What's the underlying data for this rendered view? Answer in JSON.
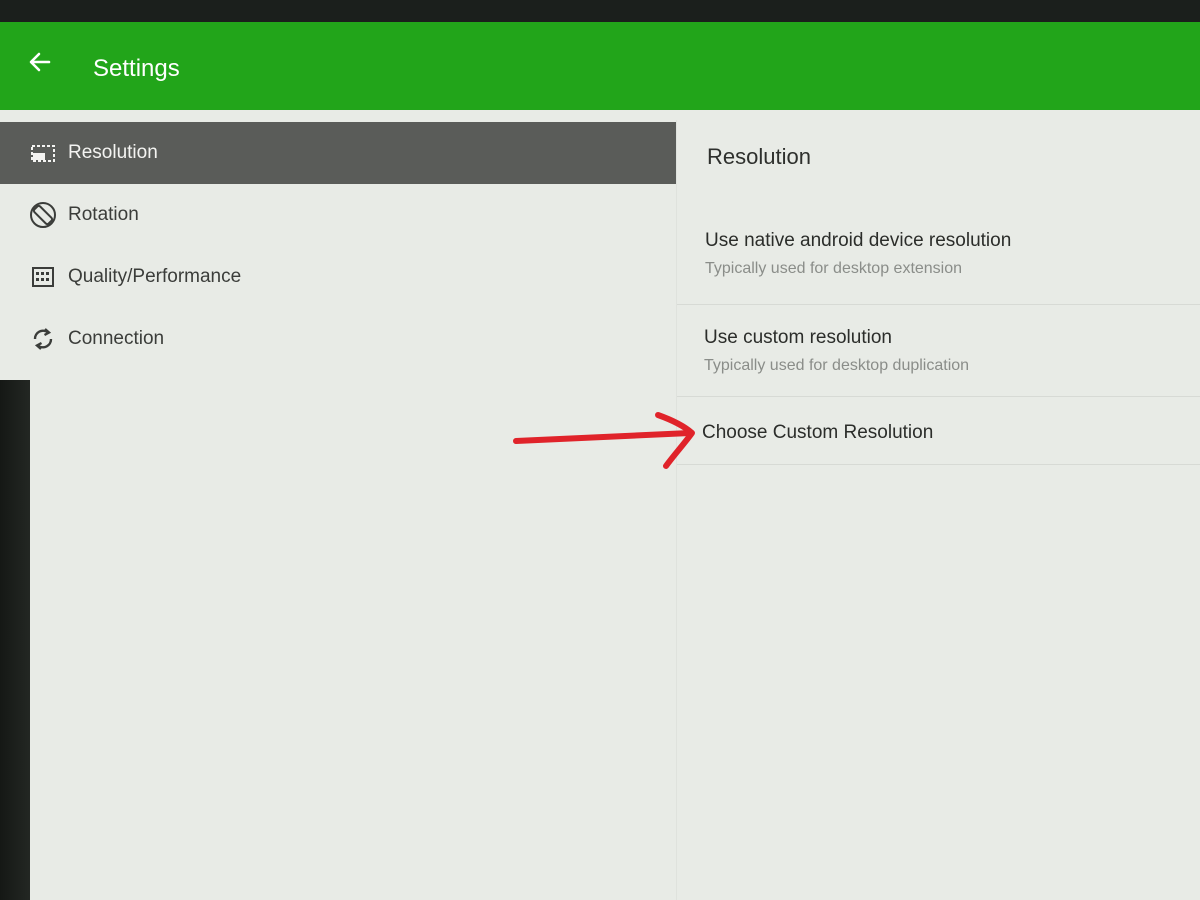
{
  "appbar": {
    "title": "Settings",
    "back_icon": "arrow-left-icon",
    "color": "#22a51a"
  },
  "sidebar": {
    "items": [
      {
        "label": "Resolution",
        "icon": "resolution-icon",
        "active": true
      },
      {
        "label": "Rotation",
        "icon": "rotation-icon",
        "active": false
      },
      {
        "label": "Quality/Performance",
        "icon": "quality-icon",
        "active": false
      },
      {
        "label": "Connection",
        "icon": "sync-icon",
        "active": false
      }
    ]
  },
  "panel": {
    "header": "Resolution",
    "options": [
      {
        "title": "Use native android device resolution",
        "summary": "Typically used for desktop extension"
      },
      {
        "title": "Use custom resolution",
        "summary": "Typically used for desktop duplication"
      },
      {
        "title": "Choose Custom Resolution",
        "summary": ""
      }
    ]
  },
  "annotation": {
    "type": "hand-drawn arrow",
    "color": "#e0232a"
  }
}
